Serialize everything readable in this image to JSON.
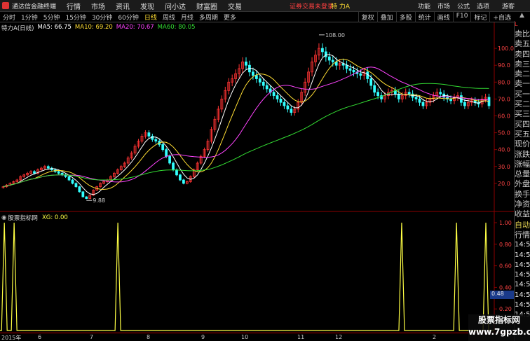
{
  "app": {
    "title": "通达信金融终端",
    "notice": "证券交易未登录",
    "stock_name": "特 力A",
    "guest": "游客"
  },
  "menu": [
    "行情",
    "市场",
    "资讯",
    "发现",
    "问小达",
    "财富圈",
    "交易"
  ],
  "titlebar_right": [
    "功能",
    "市场",
    "公式",
    "选项"
  ],
  "toolbar": {
    "periods": [
      "分时",
      "1分钟",
      "5分钟",
      "15分钟",
      "30分钟",
      "60分钟",
      "日线",
      "周线",
      "月线",
      "多周期",
      "更多"
    ],
    "active_period": "日线",
    "right_buttons": [
      "复权",
      "叠加",
      "多股",
      "统计",
      "画线",
      "F10",
      "标记",
      "+自选"
    ]
  },
  "legend": {
    "stock": "特力A(日线)",
    "ma5": "MA5: 66.75",
    "ma10": "MA10: 69.20",
    "ma20": "MA20: 70.67",
    "ma60": "MA60: 80.05"
  },
  "colors": {
    "up": "#ff3333",
    "down": "#33ffff",
    "ma5": "#ffffff",
    "ma10": "#ffdd33",
    "ma20": "#ff44ff",
    "ma60": "#33dd33",
    "indicator": "#ffff44",
    "grid": "#8b0000"
  },
  "price_axis": [
    "100.0",
    "90.0",
    "80.0",
    "70.0",
    "60.0",
    "50.0",
    "40.0",
    "30.0",
    "20.0"
  ],
  "annotations": {
    "high": "108.00",
    "low": "9.88"
  },
  "indicator": {
    "name": "股票指标网",
    "label": "XG: 0.00",
    "axis": [
      "1.00",
      "0.80",
      "0.60",
      "0.40",
      "0.20"
    ],
    "current_value": "0.48"
  },
  "date_axis": [
    "2015年",
    "6",
    "7",
    "8",
    "9",
    "10",
    "11",
    "12",
    "2"
  ],
  "right_panel": {
    "header": "L",
    "items": [
      "卖比",
      "卖五",
      "卖四",
      "卖三",
      "卖二",
      "卖一",
      "买一",
      "买二",
      "买三",
      "买四",
      "买五",
      "现价",
      "涨跌",
      "涨幅",
      "总量",
      "外盘",
      "换手",
      "净资",
      "收益"
    ],
    "auto": "自动",
    "quote": "行情",
    "times": [
      "14:50",
      "14:50",
      "14:50",
      "14:50",
      "14:50",
      "14:50",
      "14:50",
      "14:50"
    ]
  },
  "watermark": {
    "line1": "股票指标网",
    "line2": "www.7gpzb.com"
  },
  "chart_data": {
    "type": "candlestick",
    "title": "特力A(日线)",
    "ylim": [
      5,
      110
    ],
    "high_label": 108.0,
    "low_label": 9.88,
    "closes": [
      18,
      19,
      20,
      21,
      22,
      24,
      25,
      26,
      27,
      26,
      28,
      29,
      30,
      29,
      28,
      27,
      26,
      25,
      24,
      22,
      20,
      18,
      15,
      12,
      11,
      13,
      16,
      18,
      20,
      21,
      22,
      24,
      26,
      28,
      30,
      32,
      35,
      38,
      42,
      45,
      48,
      50,
      48,
      46,
      45,
      43,
      40,
      36,
      32,
      28,
      25,
      22,
      20,
      21,
      24,
      28,
      32,
      36,
      40,
      45,
      52,
      58,
      64,
      70,
      75,
      80,
      82,
      85,
      88,
      92,
      90,
      86,
      84,
      82,
      80,
      78,
      76,
      74,
      72,
      70,
      68,
      66,
      64,
      62,
      64,
      68,
      74,
      80,
      86,
      92,
      96,
      100,
      98,
      95,
      93,
      92,
      90,
      91,
      90,
      88,
      87,
      86,
      85,
      84,
      86,
      82,
      78,
      74,
      72,
      70,
      72,
      74,
      75,
      73,
      70,
      72,
      74,
      73,
      71,
      70,
      68,
      66,
      68,
      70,
      72,
      74,
      73,
      71,
      70,
      69,
      71,
      72,
      68,
      66,
      68,
      69,
      68,
      67,
      70,
      71,
      66
    ]
  }
}
